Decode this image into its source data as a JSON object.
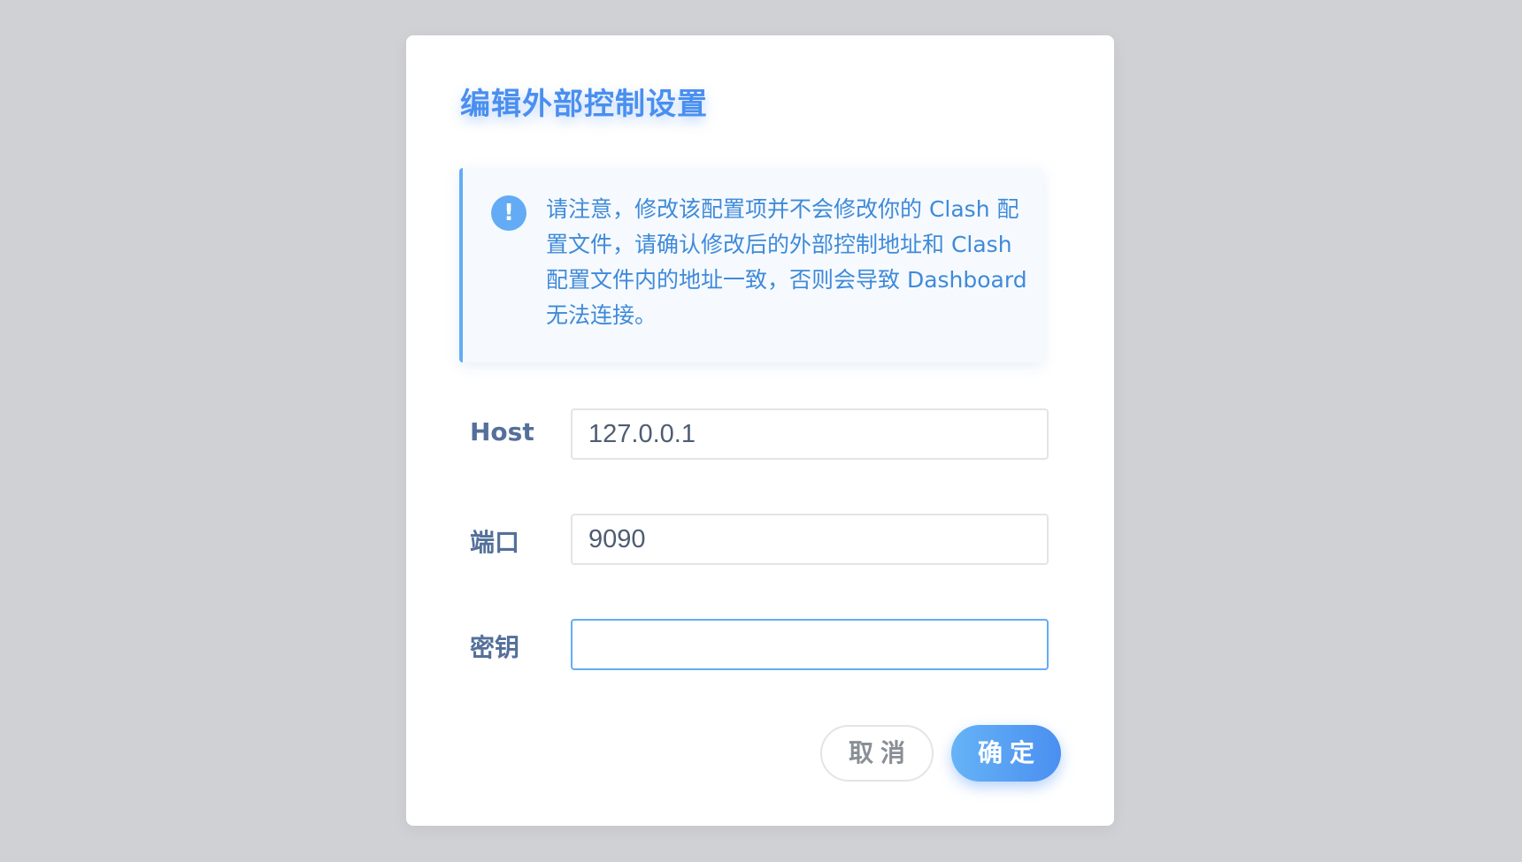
{
  "dialog": {
    "title": "编辑外部控制设置",
    "alert": {
      "icon": "info-icon",
      "icon_glyph": "!",
      "text": "请注意，修改该配置项并不会修改你的 Clash 配置文件，请确认修改后的外部控制地址和 Clash 配置文件内的地址一致，否则会导致 Dashboard 无法连接。"
    },
    "fields": {
      "host": {
        "label": "Host",
        "value": "127.0.0.1"
      },
      "port": {
        "label": "端口",
        "value": "9090"
      },
      "secret": {
        "label": "密钥",
        "value": ""
      }
    },
    "buttons": {
      "cancel": "取消",
      "ok": "确定"
    }
  },
  "colors": {
    "accent": "#4a8ff0",
    "alert_border": "#63acf5",
    "alert_text": "#3f8ad9",
    "label": "#54709a",
    "backdrop": "#d0d1d4"
  }
}
